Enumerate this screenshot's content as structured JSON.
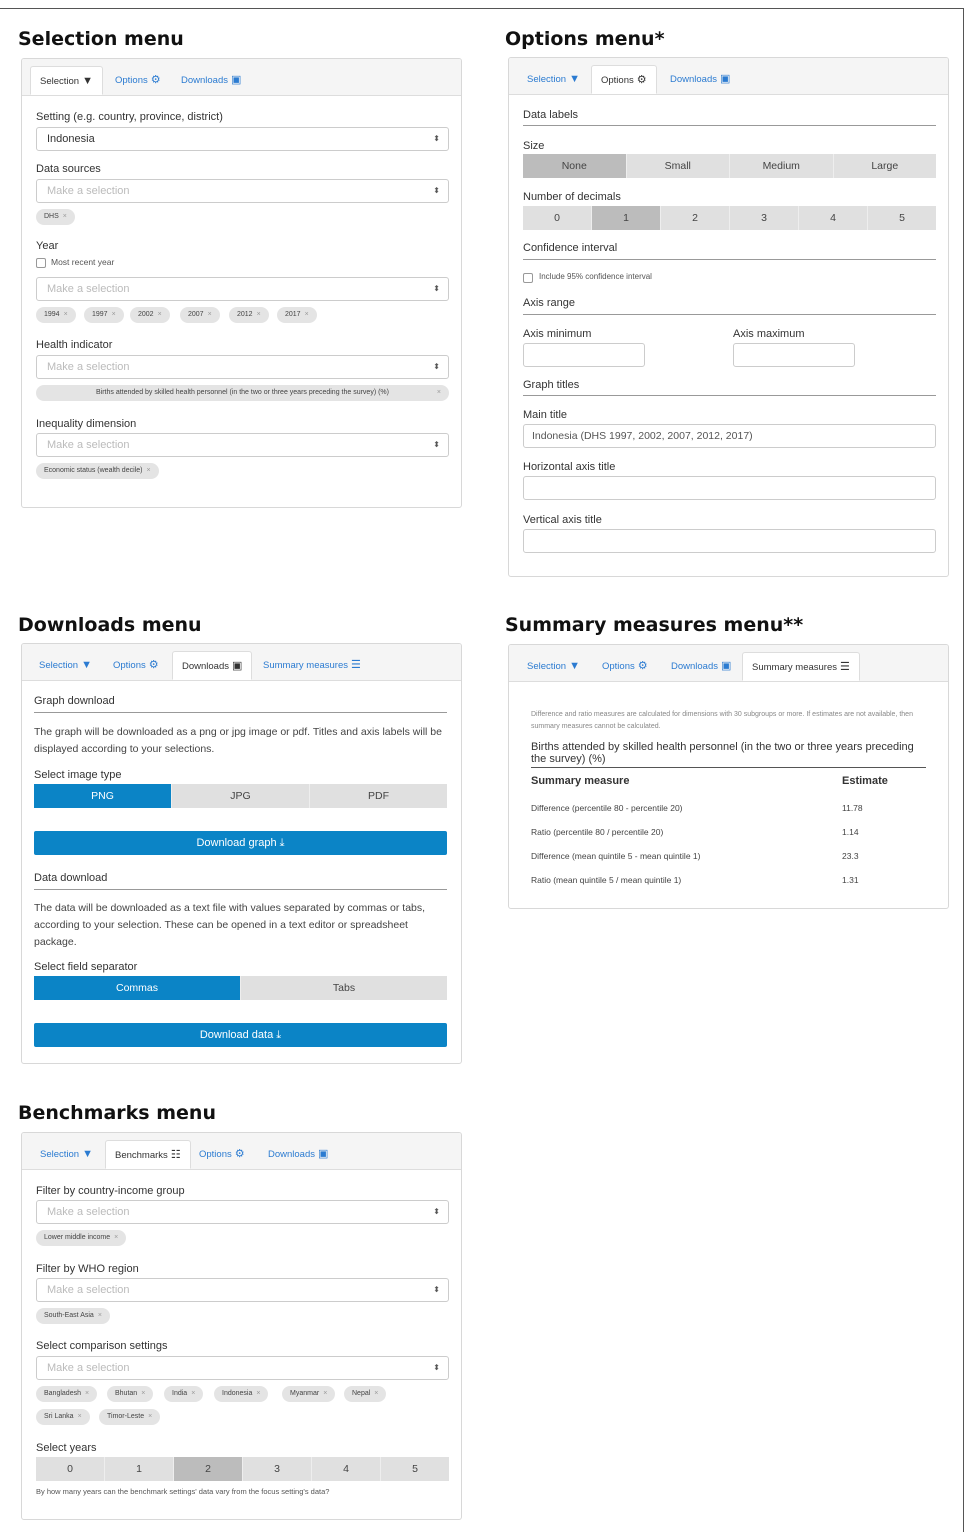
{
  "headings": {
    "selection": "Selection menu",
    "options": "Options menu*",
    "downloads": "Downloads menu",
    "summary": "Summary measures menu**",
    "benchmarks": "Benchmarks menu"
  },
  "tabs": {
    "selection": "Selection",
    "options": "Options",
    "downloads": "Downloads",
    "summary": "Summary measures",
    "benchmarks": "Benchmarks"
  },
  "selection_panel": {
    "setting_label": "Setting (e.g. country, province, district)",
    "setting_value": "Indonesia",
    "data_sources_label": "Data sources",
    "placeholder": "Make a selection",
    "data_source_chip": "DHS",
    "year_label": "Year",
    "most_recent_label": "Most recent year",
    "year_chips": [
      "1994",
      "1997",
      "2002",
      "2007",
      "2012",
      "2017"
    ],
    "health_indicator_label": "Health indicator",
    "health_indicator_chip": "Births attended by skilled health personnel (in the two or three years preceding the survey) (%)",
    "inequality_label": "Inequality dimension",
    "inequality_chip": "Economic status (wealth decile)"
  },
  "options_panel": {
    "data_labels": "Data labels",
    "size_label": "Size",
    "size_options": [
      "None",
      "Small",
      "Medium",
      "Large"
    ],
    "size_selected": "None",
    "decimals_label": "Number of decimals",
    "decimal_options": [
      "0",
      "1",
      "2",
      "3",
      "4",
      "5"
    ],
    "decimals_selected": "1",
    "ci_header": "Confidence interval",
    "ci_label": "Include 95% confidence interval",
    "axis_range": "Axis range",
    "axis_min_label": "Axis minimum",
    "axis_max_label": "Axis maximum",
    "graph_titles": "Graph titles",
    "main_title_label": "Main title",
    "main_title_value": "Indonesia (DHS 1997, 2002, 2007, 2012, 2017)",
    "h_axis_label": "Horizontal axis title",
    "v_axis_label": "Vertical axis title"
  },
  "downloads_panel": {
    "graph_download": "Graph download",
    "graph_text": "The graph will be downloaded as a png or jpg image or pdf. Titles and axis labels will be displayed according to your selections.",
    "image_type_label": "Select image type",
    "image_types": [
      "PNG",
      "JPG",
      "PDF"
    ],
    "image_selected": "PNG",
    "download_graph": "Download graph",
    "data_download": "Data download",
    "data_text": "The data will be downloaded as a text file with values separated by commas or tabs, according to your selection. These can be opened in a text editor or spreadsheet package.",
    "separator_label": "Select field separator",
    "separators": [
      "Commas",
      "Tabs"
    ],
    "separator_selected": "Commas",
    "download_data": "Download data"
  },
  "summary_panel": {
    "note": "Difference and ratio measures are calculated for dimensions with 30 subgroups or more. If estimates are not available, then summary measures cannot be calculated.",
    "indicator": "Births attended by skilled health personnel (in the two or three years preceding the survey) (%)",
    "col_measure": "Summary measure",
    "col_estimate": "Estimate",
    "rows": [
      {
        "measure": "Difference (percentile 80 - percentile 20)",
        "estimate": "11.78"
      },
      {
        "measure": "Ratio (percentile 80 / percentile 20)",
        "estimate": "1.14"
      },
      {
        "measure": "Difference (mean quintile 5 - mean quintile 1)",
        "estimate": "23.3"
      },
      {
        "measure": "Ratio (mean quintile 5 / mean quintile 1)",
        "estimate": "1.31"
      }
    ]
  },
  "benchmarks_panel": {
    "income_label": "Filter by country-income group",
    "income_chip": "Lower middle income",
    "region_label": "Filter by WHO region",
    "region_chip": "South-East Asia",
    "comparison_label": "Select comparison settings",
    "comparison_chips": [
      "Bangladesh",
      "Bhutan",
      "India",
      "Indonesia",
      "Myanmar",
      "Nepal",
      "Sri Lanka",
      "Timor-Leste"
    ],
    "years_label": "Select years",
    "year_options": [
      "0",
      "1",
      "2",
      "3",
      "4",
      "5"
    ],
    "years_selected": "2",
    "years_help": "By how many years can the benchmark settings' data vary from the focus setting's data?"
  },
  "icons": {
    "selection": "filter-icon",
    "options": "gear-icon",
    "downloads": "download-file-icon",
    "summary": "list-icon",
    "benchmarks": "sliders-icon",
    "button_download": "download-icon"
  },
  "colors": {
    "accent": "#0b84c6",
    "tab_link": "#2b7bd1"
  }
}
